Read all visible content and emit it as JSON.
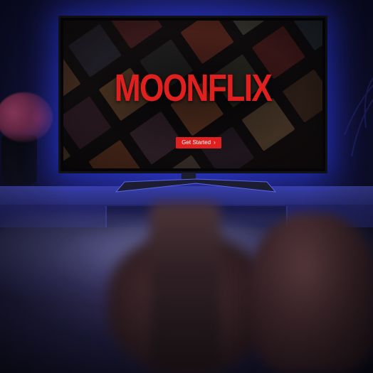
{
  "tv": {
    "brand_title": "MOONFLIX",
    "cta_label": "Get Started",
    "cta_icon": "chevron-right-icon",
    "accent_color": "#e0201e"
  },
  "scene": {
    "ambient_color": "#2a2f86",
    "backlight_color": "#3c46ff"
  }
}
